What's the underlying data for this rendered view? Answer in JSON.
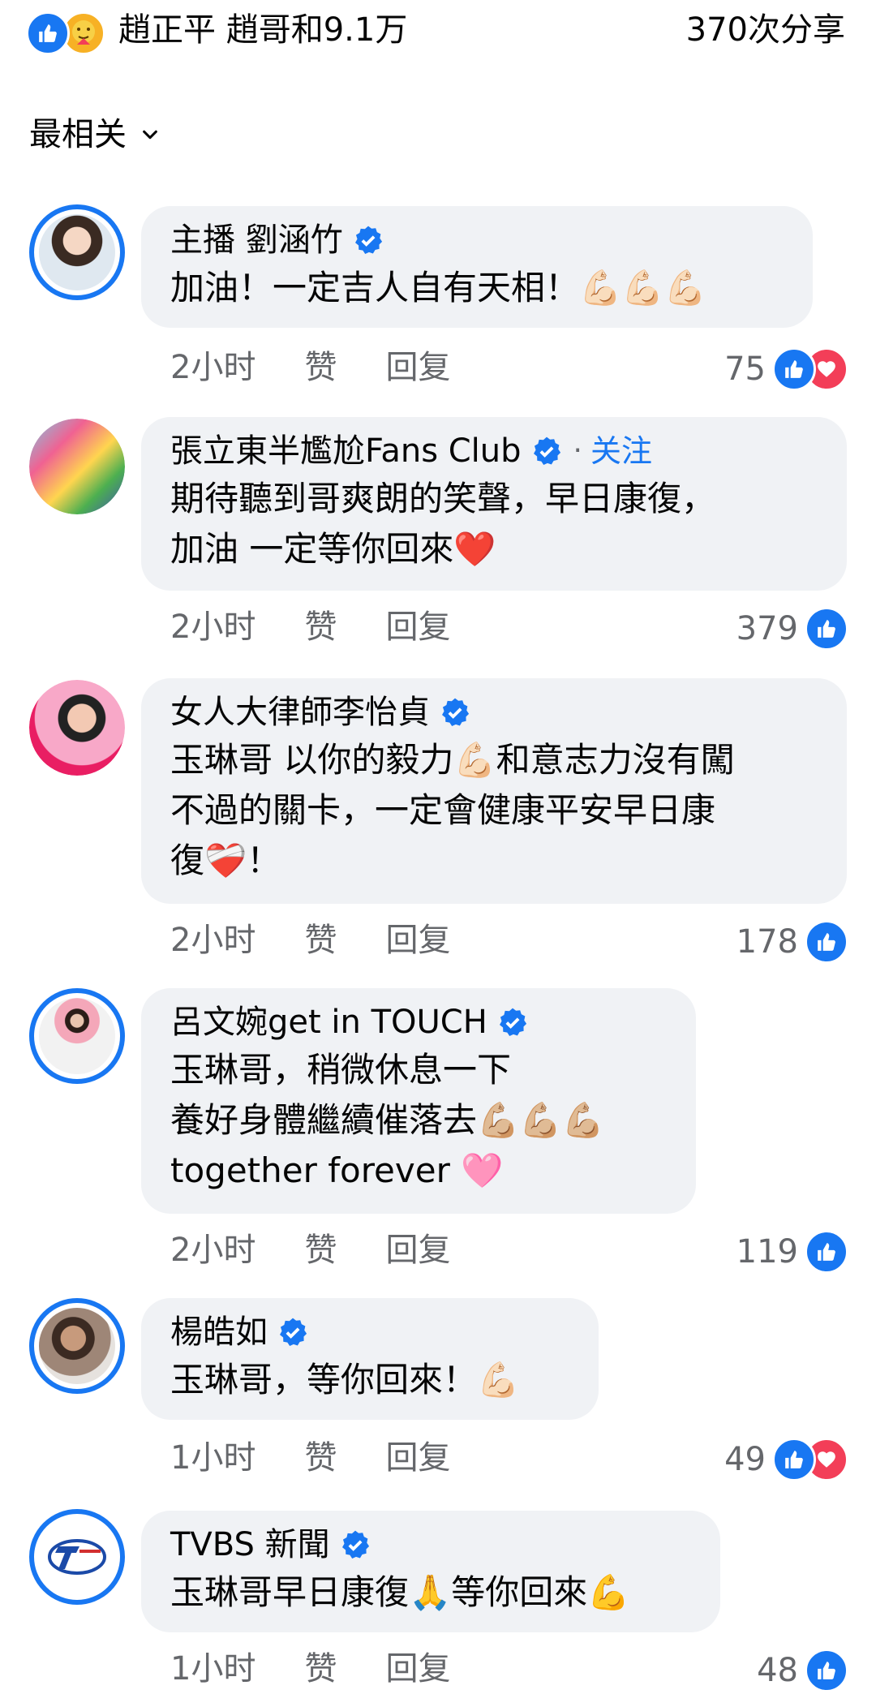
{
  "header": {
    "reaction_names": "趙正平 趙哥和9.1万",
    "share_count": "370次分享"
  },
  "sort": {
    "label": "最相关"
  },
  "comments": [
    {
      "name": "主播 劉涵竹",
      "verified": true,
      "follow": "",
      "text": "加油！一定吉人自有天相！💪🏻💪🏻💪🏻",
      "time": "2小时",
      "like": "赞",
      "reply": "回复",
      "count": "75",
      "reactions": [
        "like",
        "love"
      ]
    },
    {
      "name": "張立東半尷尬Fans Club",
      "verified": true,
      "follow": "关注",
      "text": "期待聽到哥爽朗的笑聲，早日康復，\n加油 一定等你回來❤️",
      "time": "2小时",
      "like": "赞",
      "reply": "回复",
      "count": "379",
      "reactions": [
        "like"
      ]
    },
    {
      "name": "女人大律師李怡貞",
      "verified": true,
      "follow": "",
      "text": "玉琳哥 以你的毅力💪🏻和意志力沒有闖\n不過的關卡，一定會健康平安早日康\n復❤️‍🩹！",
      "time": "2小时",
      "like": "赞",
      "reply": "回复",
      "count": "178",
      "reactions": [
        "like"
      ]
    },
    {
      "name": "呂文婉get in TOUCH",
      "verified": true,
      "follow": "",
      "text": "玉琳哥，稍微休息一下\n養好身體繼續催落去💪🏼💪🏼💪🏼\ntogether  forever 🩷",
      "time": "2小时",
      "like": "赞",
      "reply": "回复",
      "count": "119",
      "reactions": [
        "like"
      ]
    },
    {
      "name": "楊皓如",
      "verified": true,
      "follow": "",
      "text": "玉琳哥，等你回來！💪🏻",
      "time": "1小时",
      "like": "赞",
      "reply": "回复",
      "count": "49",
      "reactions": [
        "like",
        "love"
      ]
    },
    {
      "name": "TVBS 新聞",
      "verified": true,
      "follow": "",
      "text": "玉琳哥早日康復🙏等你回來💪",
      "time": "1小时",
      "like": "赞",
      "reply": "回复",
      "count": "48",
      "reactions": [
        "like"
      ]
    }
  ],
  "colors": {
    "accent": "#1877f2",
    "bubble": "#f0f2f5",
    "meta": "#65676b",
    "love": "#f33e58"
  }
}
